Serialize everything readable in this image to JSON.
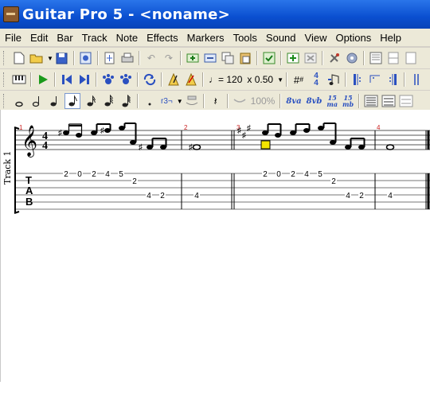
{
  "window": {
    "title": "Guitar Pro 5 - <noname>"
  },
  "menu": [
    "File",
    "Edit",
    "Bar",
    "Track",
    "Note",
    "Effects",
    "Markers",
    "Tools",
    "Sound",
    "View",
    "Options",
    "Help"
  ],
  "toolbar2": {
    "tempo": "♩= 120",
    "speed": "x 0.50"
  },
  "toolbar3": {
    "volume": "100%",
    "oct_8va": "8va",
    "oct_8vb": "8vb",
    "oct_15ma": "15\nma",
    "oct_15mb": "15\nmb",
    "triplet": "r3¬"
  },
  "score": {
    "track_name": "Track 1",
    "time_signature": "4/4",
    "bars": [
      {
        "number": "1",
        "tab": [
          "2",
          "0",
          "2",
          "4",
          "5",
          "2",
          "4",
          "2"
        ]
      },
      {
        "number": "2",
        "tab": [
          "4"
        ]
      },
      {
        "number": "3",
        "tab": [
          "2",
          "0",
          "2",
          "4",
          "5",
          "2",
          "4",
          "2"
        ]
      },
      {
        "number": "4",
        "tab": [
          "4"
        ]
      }
    ],
    "tab_label": [
      "T",
      "A",
      "B"
    ]
  },
  "colors": {
    "titlebar": "#0a4fd0",
    "bar_number": "#cc2222",
    "cursor": "#f4e400"
  }
}
